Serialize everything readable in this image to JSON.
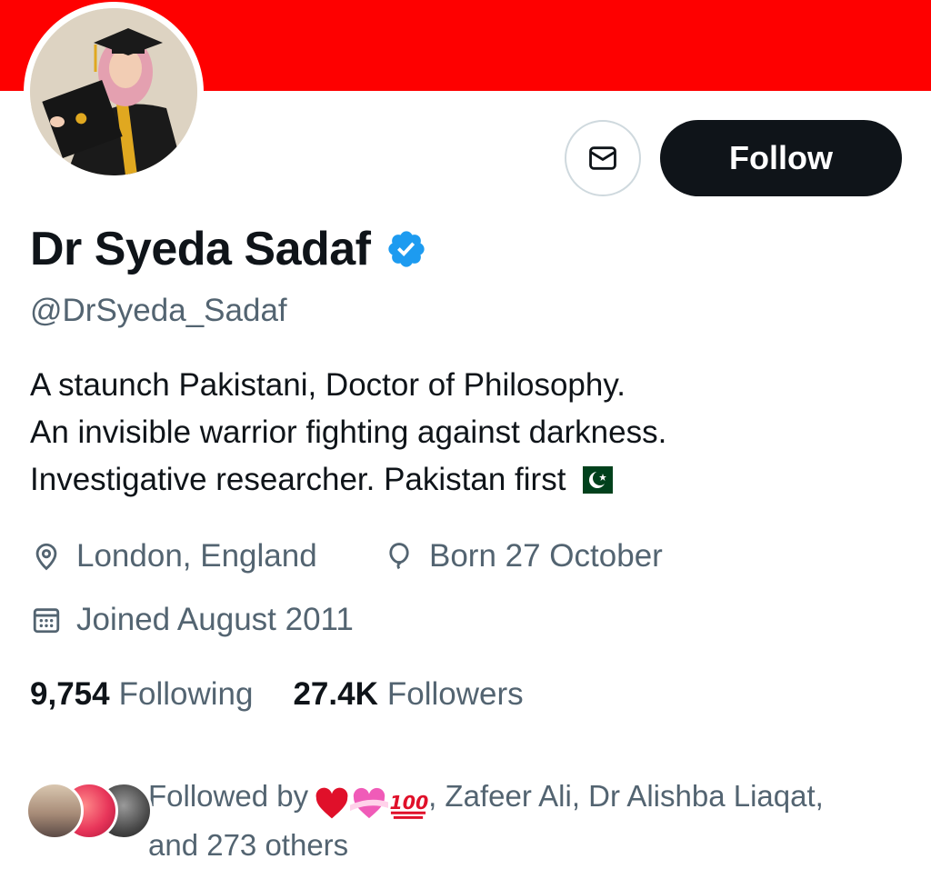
{
  "profile": {
    "name": "Dr Syeda Sadaf",
    "handle": "@DrSyeda_Sadaf",
    "bio": [
      "A staunch Pakistani, Doctor of Philosophy.",
      "An invisible warrior fighting against darkness.",
      "Investigative researcher. Pakistan first"
    ],
    "location": "London, England",
    "birthday": "Born 27 October",
    "joined": "Joined August 2011"
  },
  "actions": {
    "follow_label": "Follow"
  },
  "stats": {
    "following_count": "9,754",
    "following_label": "Following",
    "followers_count": "27.4K",
    "followers_label": "Followers"
  },
  "followed_by": {
    "prefix": "Followed by",
    "names_tail": ", Zafeer Ali, Dr Alishba Liaqat,",
    "others": "and 273 others"
  },
  "colors": {
    "banner": "#fe0000",
    "verified": "#1d9bf0",
    "follow_button": "#0f1419",
    "secondary_text": "#536471"
  },
  "icons": [
    "mail-icon",
    "verified-badge-icon",
    "location-pin-icon",
    "balloon-icon",
    "calendar-icon",
    "pakistan-flag-icon",
    "red-heart-icon",
    "heart-with-ribbon-icon",
    "hundred-points-icon"
  ]
}
